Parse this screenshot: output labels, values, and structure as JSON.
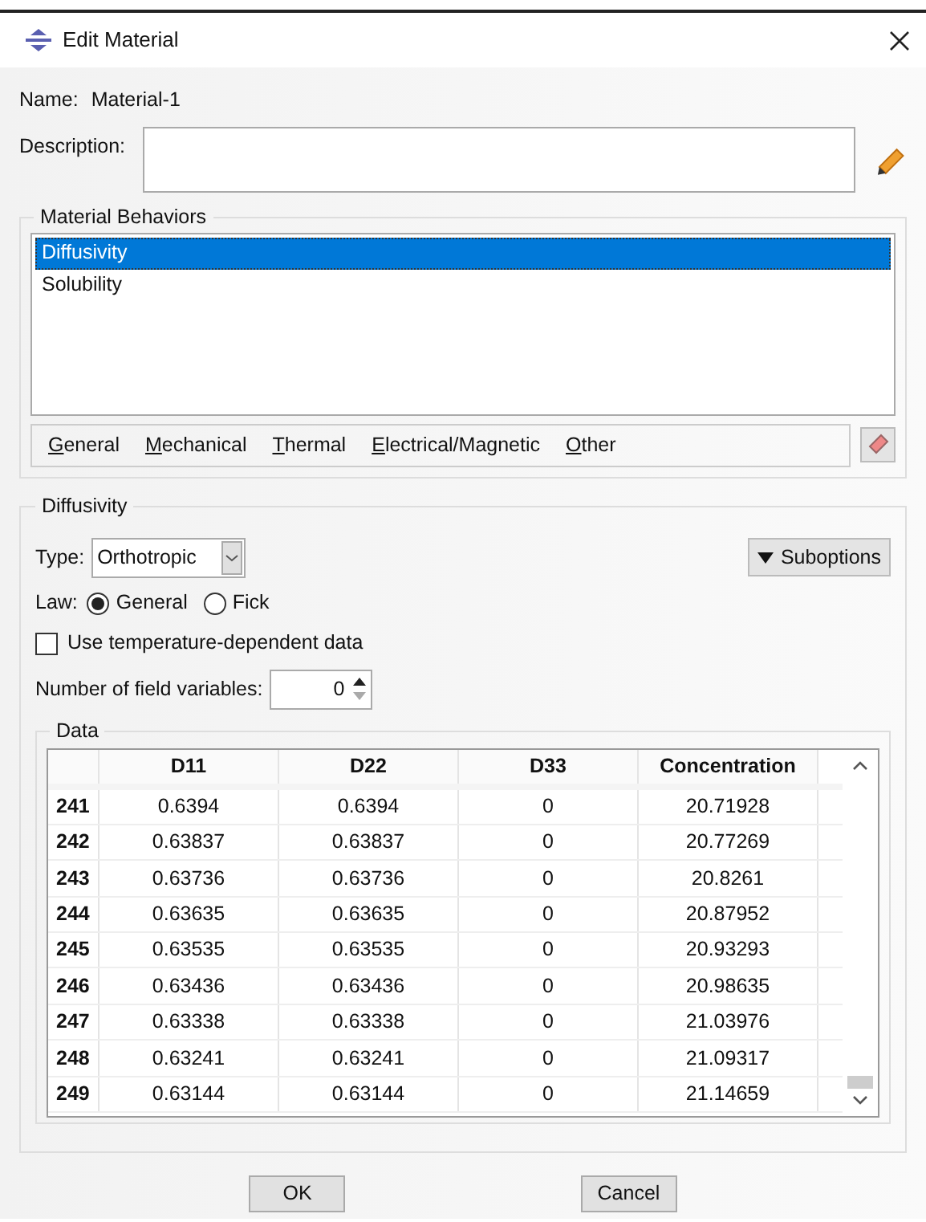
{
  "window": {
    "title": "Edit Material"
  },
  "name": {
    "label": "Name:",
    "value": "Material-1"
  },
  "description": {
    "label": "Description:"
  },
  "behaviors": {
    "title": "Material Behaviors",
    "items": [
      {
        "label": "Diffusivity",
        "selected": true
      },
      {
        "label": "Solubility",
        "selected": false
      }
    ],
    "menus": [
      "General",
      "Mechanical",
      "Thermal",
      "Electrical/Magnetic",
      "Other"
    ]
  },
  "diffusivity": {
    "title": "Diffusivity",
    "type_label": "Type:",
    "type_value": "Orthotropic",
    "suboptions": "Suboptions",
    "law_label": "Law:",
    "law_options": [
      {
        "label": "General",
        "selected": true
      },
      {
        "label": "Fick",
        "selected": false
      }
    ],
    "temperature": {
      "label": "Use temperature-dependent data",
      "checked": false
    },
    "field_variables": {
      "label": "Number of field variables:",
      "value": "0"
    },
    "data": {
      "title": "Data",
      "columns": [
        "D11",
        "D22",
        "D33",
        "Concentration"
      ],
      "rows": [
        {
          "index": "241",
          "cells": [
            "0.6394",
            "0.6394",
            "0",
            "20.71928"
          ]
        },
        {
          "index": "242",
          "cells": [
            "0.63837",
            "0.63837",
            "0",
            "20.77269"
          ]
        },
        {
          "index": "243",
          "cells": [
            "0.63736",
            "0.63736",
            "0",
            "20.8261"
          ]
        },
        {
          "index": "244",
          "cells": [
            "0.63635",
            "0.63635",
            "0",
            "20.87952"
          ]
        },
        {
          "index": "245",
          "cells": [
            "0.63535",
            "0.63535",
            "0",
            "20.93293"
          ]
        },
        {
          "index": "246",
          "cells": [
            "0.63436",
            "0.63436",
            "0",
            "20.98635"
          ]
        },
        {
          "index": "247",
          "cells": [
            "0.63338",
            "0.63338",
            "0",
            "21.03976"
          ]
        },
        {
          "index": "248",
          "cells": [
            "0.63241",
            "0.63241",
            "0",
            "21.09317"
          ]
        },
        {
          "index": "249",
          "cells": [
            "0.63144",
            "0.63144",
            "0",
            "21.14659"
          ]
        }
      ]
    }
  },
  "buttons": [
    "OK",
    "Cancel"
  ]
}
